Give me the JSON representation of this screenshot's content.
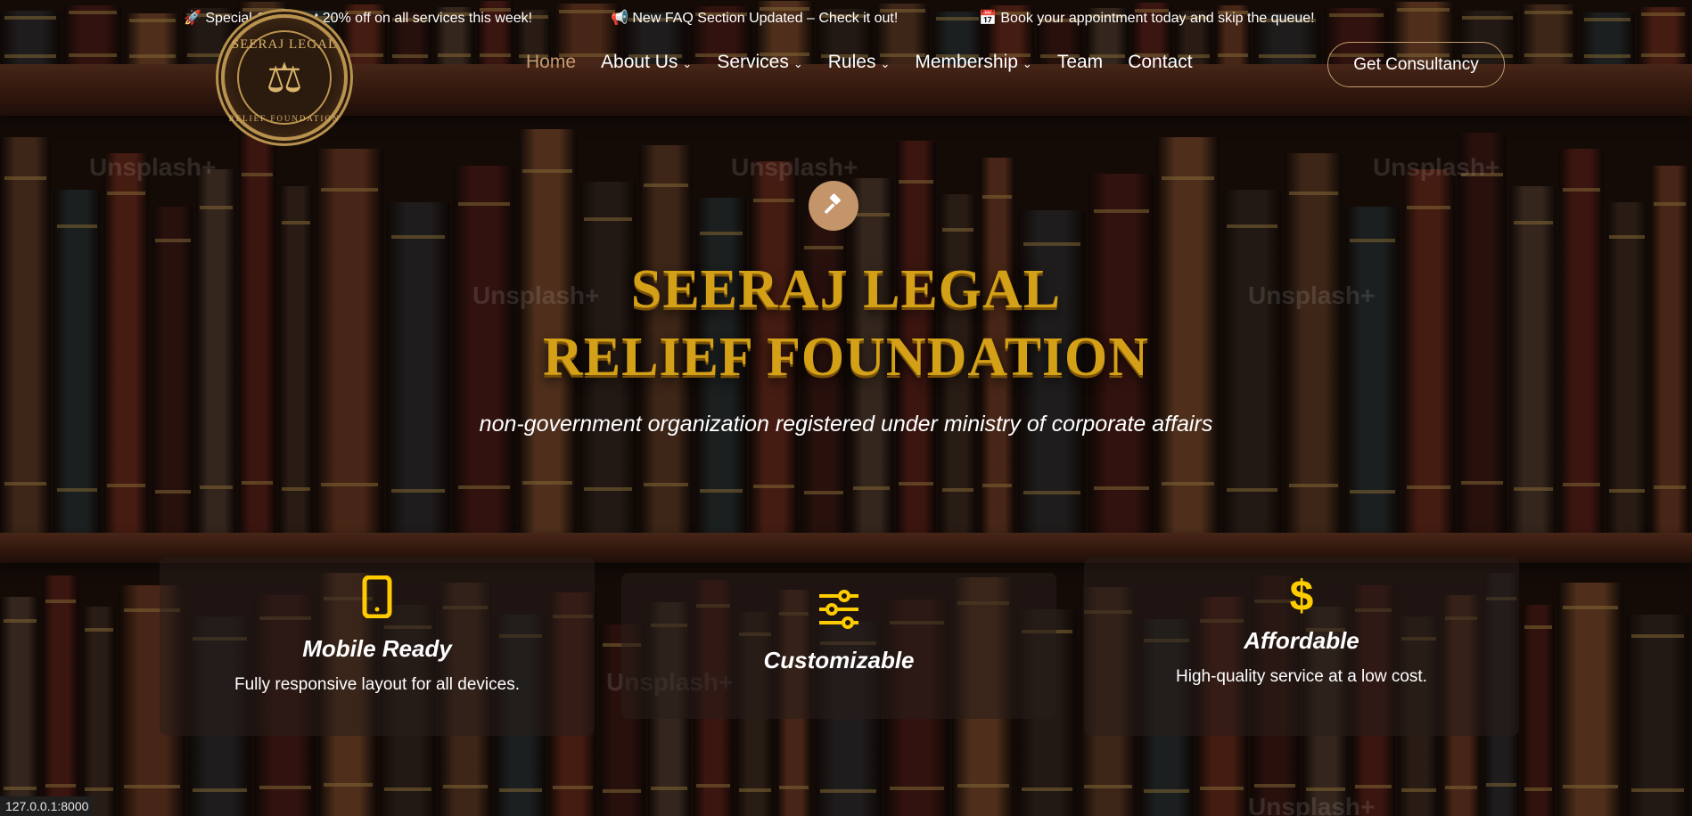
{
  "announcements": [
    {
      "icon": "🚀",
      "text": "Special Offer: Get 20% off on all services this week!"
    },
    {
      "icon": "📢",
      "text": "New FAQ Section Updated – Check it out!"
    },
    {
      "icon": "📅",
      "text": "Book your appointment today and skip the queue!"
    }
  ],
  "logo": {
    "top_text": "SEERAJ LEGAL",
    "bottom_text": "RELIEF FOUNDATION",
    "symbol": "⚖"
  },
  "nav": {
    "home": "Home",
    "about": "About Us",
    "services": "Services",
    "rules": "Rules",
    "membership": "Membership",
    "team": "Team",
    "contact": "Contact",
    "chevron": "⌄"
  },
  "cta": {
    "label": "Get Consultancy"
  },
  "hero": {
    "icon": "gavel-icon",
    "title_line1": "SEERAJ LEGAL",
    "title_line2": "RELIEF FOUNDATION",
    "subtitle": "non-government organization registered under ministry of corporate affairs"
  },
  "features": [
    {
      "icon": "📱",
      "title": "Mobile Ready",
      "desc": "Fully responsive layout for all devices."
    },
    {
      "icon": "⚙",
      "title": "Customizable",
      "desc": ""
    },
    {
      "icon": "$",
      "title": "Affordable",
      "desc": "High-quality service at a low cost."
    }
  ],
  "watermark": "Unsplash+",
  "status_bar": "127.0.0.1:8000",
  "colors": {
    "gold": "#d4a017",
    "accent": "#c4946a",
    "icon_yellow": "#ffcc00"
  }
}
